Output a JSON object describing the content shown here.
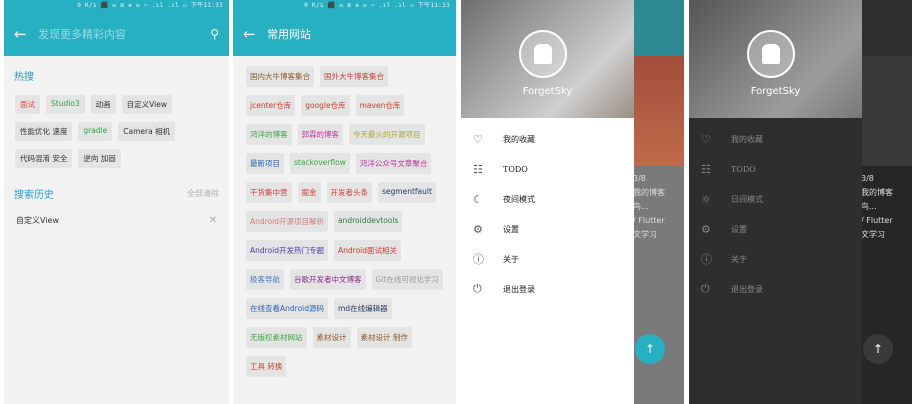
{
  "statusbar": {
    "text": "0 K/s ⬛ ✉ ⧈ ❖ ✉ ⋯ .ıl .ıl ▭ 下午11:33"
  },
  "search_screen": {
    "search_placeholder": "发现更多精彩内容",
    "hot_title": "热搜",
    "hot_tags": [
      {
        "label": "面试",
        "color": "#e14a3c"
      },
      {
        "label": "Studio3",
        "color": "#2aa84a"
      },
      {
        "label": "动画",
        "color": "#333333"
      },
      {
        "label": "自定义View",
        "color": "#333333"
      },
      {
        "label": "性能优化 速度",
        "color": "#333333"
      },
      {
        "label": "gradle",
        "color": "#2aa84a"
      },
      {
        "label": "Camera 相机",
        "color": "#333333"
      },
      {
        "label": "代码混淆 安全",
        "color": "#333333"
      },
      {
        "label": "逆向 加固",
        "color": "#333333"
      }
    ],
    "history_title": "搜索历史",
    "clear_all": "全部清除",
    "history_items": [
      {
        "label": "自定义View"
      }
    ]
  },
  "sites_screen": {
    "title": "常用网站",
    "tags": [
      {
        "label": "国内大牛博客集合",
        "color": "#8a5a2a"
      },
      {
        "label": "国外大牛博客集合",
        "color": "#d23c3c"
      },
      {
        "label": "jcenter仓库",
        "color": "#c8402c"
      },
      {
        "label": "google仓库",
        "color": "#c8402c"
      },
      {
        "label": "maven仓库",
        "color": "#c8402c"
      },
      {
        "label": "鸿洋的博客",
        "color": "#3aa844"
      },
      {
        "label": "郭霖的博客",
        "color": "#c0399c"
      },
      {
        "label": "今天最火的开源项目",
        "color": "#a8a82a"
      },
      {
        "label": "最新项目",
        "color": "#2a64b4"
      },
      {
        "label": "stackoverflow",
        "color": "#3aa844"
      },
      {
        "label": "鸿洋公众号文章聚合",
        "color": "#c0399c"
      },
      {
        "label": "干货集中营",
        "color": "#d23c3c"
      },
      {
        "label": "掘金",
        "color": "#d23c3c"
      },
      {
        "label": "开发者头条",
        "color": "#d23c3c"
      },
      {
        "label": "segmentfault",
        "color": "#2a3a66"
      },
      {
        "label": "Android开源项目解析",
        "color": "#d27a7a"
      },
      {
        "label": "androiddevtools",
        "color": "#2a7a3a"
      },
      {
        "label": "Android开发热门专题",
        "color": "#4a3aa8"
      },
      {
        "label": "Android面试相关",
        "color": "#c8402c"
      },
      {
        "label": "极客导航",
        "color": "#4a7ac8"
      },
      {
        "label": "谷歌开发者中文博客",
        "color": "#8a2a8a"
      },
      {
        "label": "Git在线可视化学习",
        "color": "#9a9a9a"
      },
      {
        "label": "在线查看Android源码",
        "color": "#2a64b4"
      },
      {
        "label": "md在线编辑器",
        "color": "#2a3a66"
      },
      {
        "label": "无版权素材网站",
        "color": "#3aa844"
      },
      {
        "label": "素材设计",
        "color": "#8a5a2a"
      },
      {
        "label": "素材设计 制作",
        "color": "#8a5a2a"
      },
      {
        "label": "工具 转换",
        "color": "#c8402c"
      }
    ]
  },
  "drawer": {
    "username": "ForgetSky",
    "items_light": [
      {
        "label": "我的收藏",
        "icon": "heart-icon",
        "glyph": "♡"
      },
      {
        "label": "TODO",
        "icon": "todo-icon",
        "glyph": "☷"
      },
      {
        "label": "夜间模式",
        "icon": "moon-icon",
        "glyph": "☾"
      },
      {
        "label": "设置",
        "icon": "gear-icon",
        "glyph": "⚙"
      },
      {
        "label": "关于",
        "icon": "info-icon",
        "glyph": "ⓘ"
      },
      {
        "label": "退出登录",
        "icon": "power-icon",
        "glyph": "⏻"
      }
    ],
    "items_dark": [
      {
        "label": "我的收藏",
        "icon": "heart-icon",
        "glyph": "♡"
      },
      {
        "label": "TODO",
        "icon": "todo-icon",
        "glyph": "☷"
      },
      {
        "label": "日间模式",
        "icon": "sun-icon",
        "glyph": "☼"
      },
      {
        "label": "设置",
        "icon": "gear-icon",
        "glyph": "⚙"
      },
      {
        "label": "关于",
        "icon": "info-icon",
        "glyph": "ⓘ"
      },
      {
        "label": "退出登录",
        "icon": "power-icon",
        "glyph": "⏻"
      }
    ],
    "bg_page": "3/8",
    "bg_text1": "我的博客",
    "bg_text2": "鸟...",
    "bg_text3": "/ Flutter",
    "bg_text4": "文学习",
    "fab": "↑"
  },
  "colors": {
    "primary": "#26b0c1",
    "accent_blue": "#1e9fd6"
  }
}
